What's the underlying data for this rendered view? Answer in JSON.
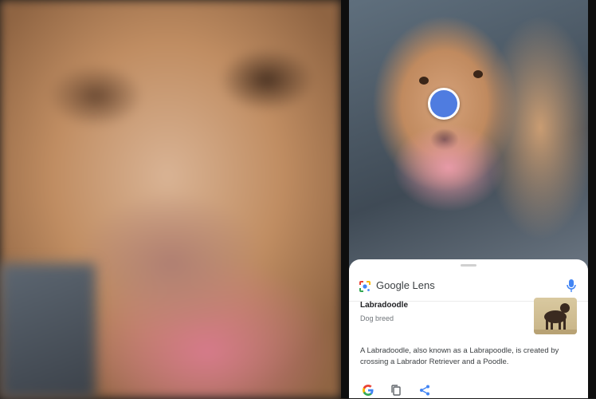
{
  "lens": {
    "brand_google": "Google",
    "brand_lens": "Lens"
  },
  "result": {
    "title": "Labradoodle",
    "subtitle": "Dog breed",
    "description": "A Labradoodle, also known as a Labrapoodle, is created by crossing a Labrador Retriever and a Poodle."
  },
  "icons": {
    "lens": "google-lens-icon",
    "mic": "microphone-icon",
    "google": "google-g-icon",
    "copy": "copy-icon",
    "share": "share-icon"
  },
  "colors": {
    "blue": "#4285F4",
    "red": "#EA4335",
    "yellow": "#FBBC05",
    "green": "#34A853",
    "selection_dot": "#4f7ce0"
  }
}
